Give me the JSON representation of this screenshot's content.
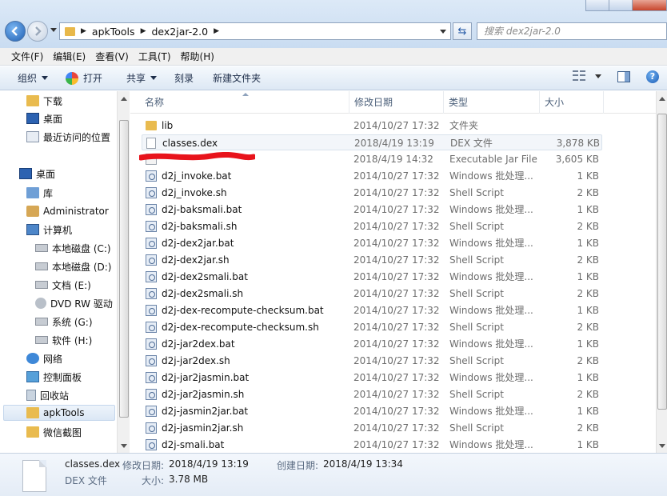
{
  "address": {
    "crumbs": [
      "apkTools",
      "dex2jar-2.0"
    ],
    "search_placeholder": "搜索 dex2jar-2.0"
  },
  "menu": [
    "文件(F)",
    "编辑(E)",
    "查看(V)",
    "工具(T)",
    "帮助(H)"
  ],
  "commands": {
    "organize": "组织",
    "open": "打开",
    "share": "共享",
    "burn": "刻录",
    "new_folder": "新建文件夹"
  },
  "nav": {
    "items": [
      "下载",
      "桌面",
      "最近访问的位置",
      "桌面",
      "库",
      "Administrator",
      "计算机",
      "本地磁盘 (C:)",
      "本地磁盘 (D:)",
      "文档 (E:)",
      "DVD RW 驱动",
      "系统 (G:)",
      "软件 (H:)",
      "网络",
      "控制面板",
      "回收站",
      "apkTools",
      "微信截图"
    ]
  },
  "columns": {
    "name": "名称",
    "date": "修改日期",
    "type": "类型",
    "size": "大小"
  },
  "files": [
    {
      "name": "lib",
      "date": "2014/10/27 17:32",
      "type": "文件夹",
      "size": "",
      "icon": "folder"
    },
    {
      "name": "classes.dex",
      "date": "2018/4/19 13:19",
      "type": "DEX 文件",
      "size": "3,878 KB",
      "icon": "dex"
    },
    {
      "name": "",
      "date": "2018/4/19 14:32",
      "type": "Executable Jar File",
      "size": "3,605 KB",
      "icon": "jar"
    },
    {
      "name": "d2j_invoke.bat",
      "date": "2014/10/27 17:32",
      "type": "Windows 批处理...",
      "size": "1 KB",
      "icon": "bat"
    },
    {
      "name": "d2j_invoke.sh",
      "date": "2014/10/27 17:32",
      "type": "Shell Script",
      "size": "2 KB",
      "icon": "sh"
    },
    {
      "name": "d2j-baksmali.bat",
      "date": "2014/10/27 17:32",
      "type": "Windows 批处理...",
      "size": "1 KB",
      "icon": "bat"
    },
    {
      "name": "d2j-baksmali.sh",
      "date": "2014/10/27 17:32",
      "type": "Shell Script",
      "size": "2 KB",
      "icon": "sh"
    },
    {
      "name": "d2j-dex2jar.bat",
      "date": "2014/10/27 17:32",
      "type": "Windows 批处理...",
      "size": "1 KB",
      "icon": "bat"
    },
    {
      "name": "d2j-dex2jar.sh",
      "date": "2014/10/27 17:32",
      "type": "Shell Script",
      "size": "2 KB",
      "icon": "sh"
    },
    {
      "name": "d2j-dex2smali.bat",
      "date": "2014/10/27 17:32",
      "type": "Windows 批处理...",
      "size": "1 KB",
      "icon": "bat"
    },
    {
      "name": "d2j-dex2smali.sh",
      "date": "2014/10/27 17:32",
      "type": "Shell Script",
      "size": "2 KB",
      "icon": "sh"
    },
    {
      "name": "d2j-dex-recompute-checksum.bat",
      "date": "2014/10/27 17:32",
      "type": "Windows 批处理...",
      "size": "1 KB",
      "icon": "bat"
    },
    {
      "name": "d2j-dex-recompute-checksum.sh",
      "date": "2014/10/27 17:32",
      "type": "Shell Script",
      "size": "2 KB",
      "icon": "sh"
    },
    {
      "name": "d2j-jar2dex.bat",
      "date": "2014/10/27 17:32",
      "type": "Windows 批处理...",
      "size": "1 KB",
      "icon": "bat"
    },
    {
      "name": "d2j-jar2dex.sh",
      "date": "2014/10/27 17:32",
      "type": "Shell Script",
      "size": "2 KB",
      "icon": "sh"
    },
    {
      "name": "d2j-jar2jasmin.bat",
      "date": "2014/10/27 17:32",
      "type": "Windows 批处理...",
      "size": "1 KB",
      "icon": "bat"
    },
    {
      "name": "d2j-jar2jasmin.sh",
      "date": "2014/10/27 17:32",
      "type": "Shell Script",
      "size": "2 KB",
      "icon": "sh"
    },
    {
      "name": "d2j-jasmin2jar.bat",
      "date": "2014/10/27 17:32",
      "type": "Windows 批处理...",
      "size": "1 KB",
      "icon": "bat"
    },
    {
      "name": "d2j-jasmin2jar.sh",
      "date": "2014/10/27 17:32",
      "type": "Shell Script",
      "size": "2 KB",
      "icon": "sh"
    },
    {
      "name": "d2j-smali.bat",
      "date": "2014/10/27 17:32",
      "type": "Windows 批处理...",
      "size": "1 KB",
      "icon": "bat"
    }
  ],
  "details": {
    "filename": "classes.dex",
    "filetype": "DEX 文件",
    "modified_label": "修改日期:",
    "modified_value": "2018/4/19 13:19",
    "created_label": "创建日期:",
    "created_value": "2018/4/19 13:34",
    "size_label": "大小:",
    "size_value": "3.78 MB"
  },
  "redaction_color": "#e8131b"
}
